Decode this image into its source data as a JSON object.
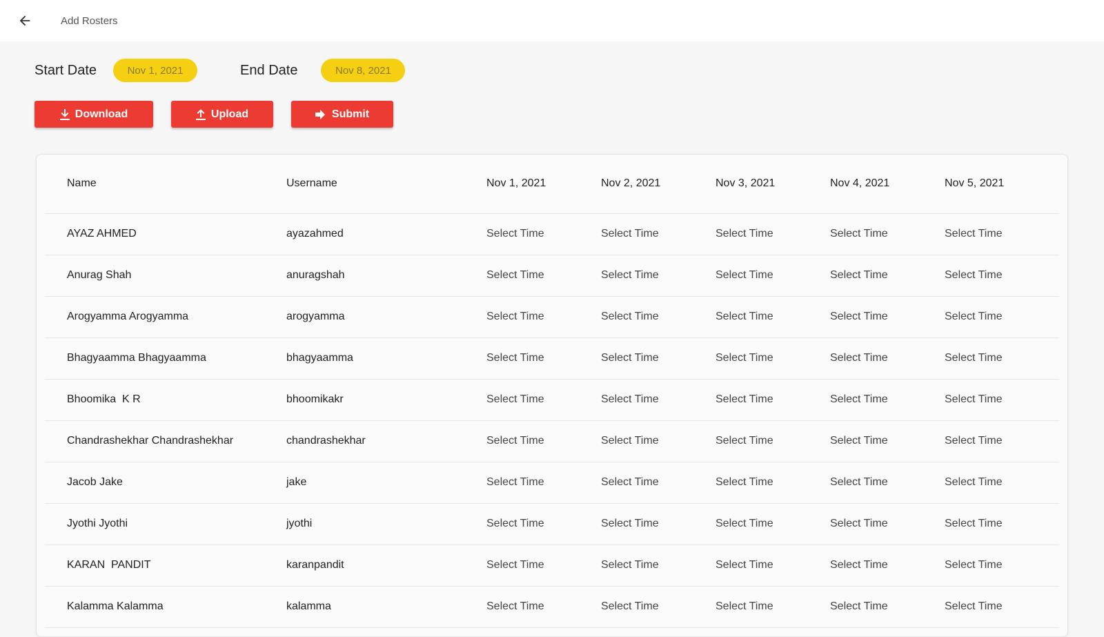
{
  "header": {
    "title": "Add Rosters",
    "back_icon": "arrow-left-icon"
  },
  "dates": {
    "start_label": "Start Date",
    "start_value": "Nov 1, 2021",
    "end_label": "End Date",
    "end_value": "Nov 8, 2021"
  },
  "actions": {
    "download_label": "Download",
    "upload_label": "Upload",
    "submit_label": "Submit"
  },
  "colors": {
    "accent_red": "#ec3b32",
    "chip_yellow": "#f5cf12"
  },
  "table": {
    "columns": [
      "Name",
      "Username",
      "Nov 1, 2021",
      "Nov 2, 2021",
      "Nov 3, 2021",
      "Nov 4, 2021",
      "Nov 5, 2021"
    ],
    "cell_placeholder": "Select Time",
    "rows": [
      {
        "name": "AYAZ AHMED",
        "username": "ayazahmed"
      },
      {
        "name": "Anurag Shah",
        "username": "anuragshah"
      },
      {
        "name": "Arogyamma Arogyamma",
        "username": "arogyamma"
      },
      {
        "name": "Bhagyaamma Bhagyaamma",
        "username": "bhagyaamma"
      },
      {
        "name": "Bhoomika  K R",
        "username": "bhoomikakr"
      },
      {
        "name": "Chandrashekhar Chandrashekhar",
        "username": "chandrashekhar"
      },
      {
        "name": "Jacob Jake",
        "username": "jake"
      },
      {
        "name": "Jyothi Jyothi",
        "username": "jyothi"
      },
      {
        "name": "KARAN  PANDIT",
        "username": "karanpandit"
      },
      {
        "name": "Kalamma Kalamma",
        "username": "kalamma"
      }
    ]
  }
}
